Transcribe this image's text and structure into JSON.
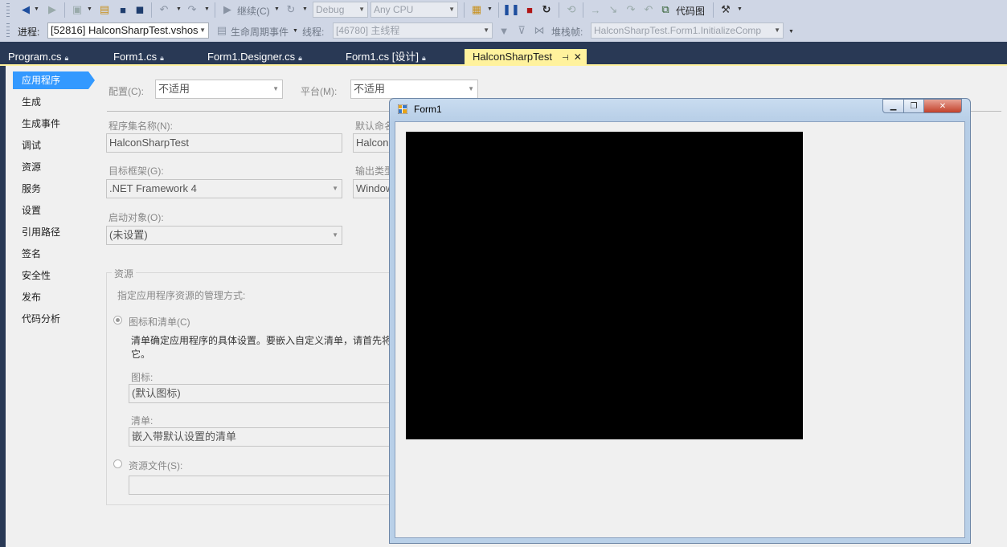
{
  "toolbar1": {
    "continue_label": "继续(C)",
    "config_combo": "Debug",
    "platform_combo": "Any CPU",
    "codemap_label": "代码图"
  },
  "toolbar2": {
    "process_label": "进程:",
    "process_value": "[52816] HalconSharpTest.vshos",
    "lifecycle_label": "生命周期事件",
    "thread_label": "线程:",
    "thread_value": "[46780] 主线程",
    "stackframe_label": "堆栈帧:",
    "stackframe_value": "HalconSharpTest.Form1.InitializeComp"
  },
  "tabs": [
    {
      "label": "Program.cs"
    },
    {
      "label": "Form1.cs"
    },
    {
      "label": "Form1.Designer.cs"
    },
    {
      "label": "Form1.cs [设计]"
    },
    {
      "label": "HalconSharpTest"
    }
  ],
  "sidebar": {
    "items": [
      {
        "label": "应用程序"
      },
      {
        "label": "生成"
      },
      {
        "label": "生成事件"
      },
      {
        "label": "调试"
      },
      {
        "label": "资源"
      },
      {
        "label": "服务"
      },
      {
        "label": "设置"
      },
      {
        "label": "引用路径"
      },
      {
        "label": "签名"
      },
      {
        "label": "安全性"
      },
      {
        "label": "发布"
      },
      {
        "label": "代码分析"
      }
    ]
  },
  "app_page": {
    "config_label": "配置(C):",
    "config_value": "不适用",
    "platform_label": "平台(M):",
    "platform_value": "不适用",
    "assembly_name_label": "程序集名称(N):",
    "assembly_name_value": "HalconSharpTest",
    "default_ns_label": "默认命名",
    "default_ns_value": "HalconS",
    "target_fw_label": "目标框架(G):",
    "target_fw_value": ".NET Framework 4",
    "output_type_label": "输出类型",
    "output_type_value": "Window",
    "startup_label": "启动对象(O):",
    "startup_value": "(未设置)",
    "resources_group": "资源",
    "resources_desc": "指定应用程序资源的管理方式:",
    "radio_icon_manifest": "图标和清单(C)",
    "manifest_desc_1": "清单确定应用程序的具体设置。要嵌入自定义清单，请首先将",
    "manifest_desc_2": "它。",
    "icon_label": "图标:",
    "icon_value": "(默认图标)",
    "manifest_label": "清单:",
    "manifest_value": "嵌入带默认设置的清单",
    "radio_resource_file": "资源文件(S):"
  },
  "form1": {
    "title": "Form1"
  }
}
